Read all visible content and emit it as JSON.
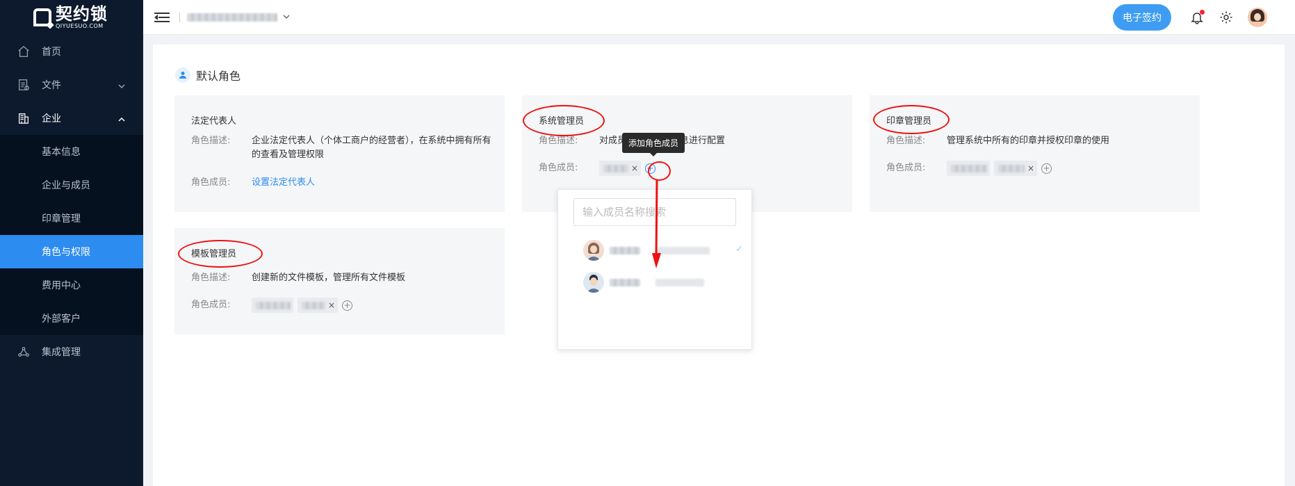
{
  "brand": {
    "name": "契约锁",
    "sub": "QIYUESUO.COM"
  },
  "sidebar": {
    "items": [
      {
        "label": "首页"
      },
      {
        "label": "文件"
      },
      {
        "label": "企业"
      },
      {
        "label": "集成管理"
      }
    ],
    "enterprise_sub": [
      {
        "label": "基本信息"
      },
      {
        "label": "企业与成员"
      },
      {
        "label": "印章管理"
      },
      {
        "label": "角色与权限"
      },
      {
        "label": "费用中心"
      },
      {
        "label": "外部客户"
      }
    ]
  },
  "header": {
    "esign_label": "电子签约"
  },
  "section": {
    "title": "默认角色"
  },
  "labels": {
    "desc": "角色描述:",
    "members": "角色成员:"
  },
  "cards": {
    "legal": {
      "title": "法定代表人",
      "desc": "企业法定代表人（个体工商户的经营者），在系统中拥有所有的查看及管理权限",
      "action": "设置法定代表人"
    },
    "sysadmin": {
      "title": "系统管理员",
      "desc": "对成员",
      "desc_tail": "息进行配置"
    },
    "seal": {
      "title": "印章管理员",
      "desc": "管理系统中所有的印章并授权印章的使用"
    },
    "template": {
      "title": "模板管理员",
      "desc": "创建新的文件模板，管理所有文件模板"
    }
  },
  "tooltip": {
    "text": "添加角色成员"
  },
  "dropdown": {
    "placeholder": "输入成员名称搜索",
    "selected_check": "✓"
  },
  "tag_close": "×",
  "plus_symbol": "+",
  "colors": {
    "primary": "#2d8cf0",
    "sidebar_bg": "#0d1a2e",
    "annotation": "#ee1111"
  }
}
